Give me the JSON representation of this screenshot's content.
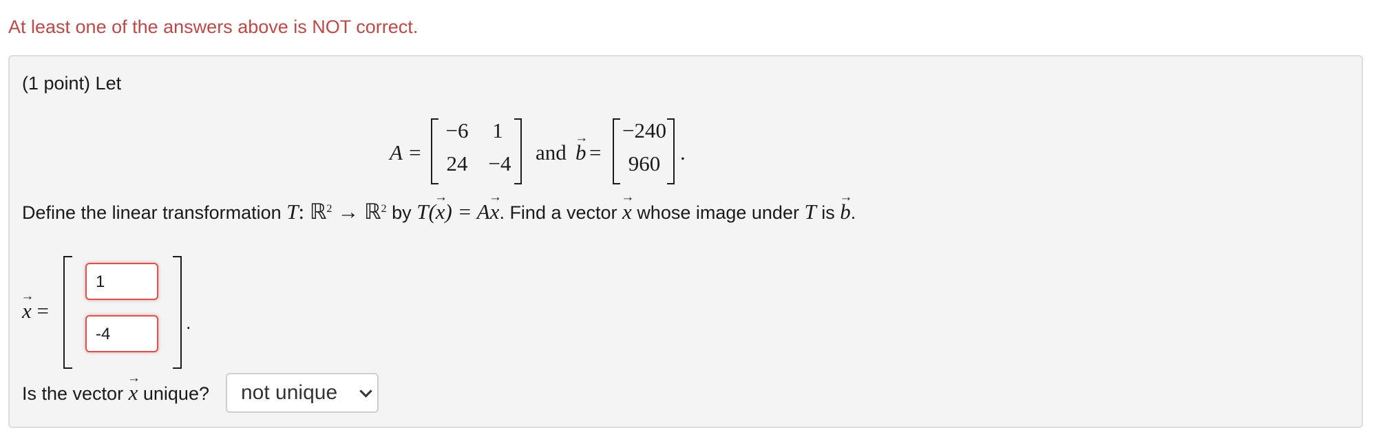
{
  "banner": "At least one of the answers above is NOT correct.",
  "problem": {
    "intro": "(1 point) Let",
    "matrix_A_label": "A =",
    "matrix_A": [
      [
        "−6",
        "1"
      ],
      [
        "24",
        "−4"
      ]
    ],
    "and_text": "and",
    "vector_b_symbol": "b",
    "equals": "=",
    "vector_b": [
      "−240",
      "960"
    ],
    "define_prefix": "Define the linear transformation",
    "T": "T",
    "mapping": ": ℝ",
    "arrow_to": " → ℝ",
    "exponent": "2",
    "by_text": "by",
    "formula_left": "T(",
    "formula_right": ") = A",
    "find_text": ". Find a vector",
    "whose_text": "whose image under",
    "is_text": "is",
    "x_symbol": "x",
    "end_period": "."
  },
  "answer": {
    "label_eq": " =",
    "values": [
      "1",
      "-4"
    ],
    "period": "."
  },
  "uniqueness": {
    "question_prefix": "Is the vector",
    "question_suffix": "unique?",
    "selected_option": "not unique"
  },
  "colors": {
    "error_text": "#b94a48",
    "error_border": "#d9534f",
    "panel_bg": "#f4f4f4"
  }
}
